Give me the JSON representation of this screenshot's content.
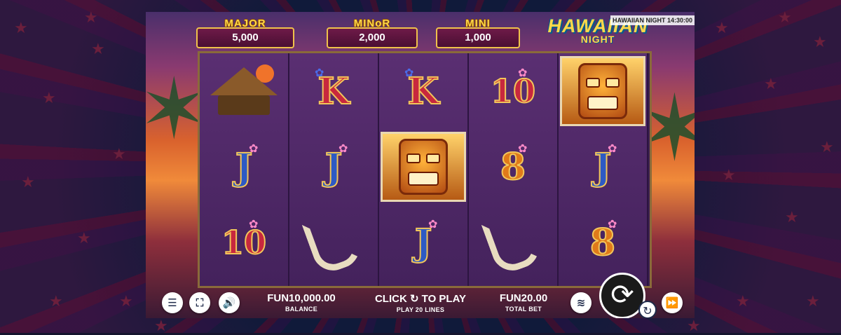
{
  "jackpots": [
    {
      "label": "MAJOR",
      "value": "5,000"
    },
    {
      "label": "MINoR",
      "value": "2,000"
    },
    {
      "label": "MINI",
      "value": "1,000"
    }
  ],
  "logo": {
    "line1": "HAWAIIAN",
    "line2": "NIGHT"
  },
  "clock": "HAWAIIAN NIGHT 14:30:00",
  "reels": [
    [
      "hut",
      "J",
      "10"
    ],
    [
      "K",
      "J",
      "hook"
    ],
    [
      "K",
      "tiki",
      "J"
    ],
    [
      "10",
      "8",
      "hook"
    ],
    [
      "tiki",
      "J",
      "8"
    ]
  ],
  "bottom": {
    "menu_icon": "menu-icon",
    "fullscreen_icon": "fullscreen-icon",
    "sound_icon": "sound-icon",
    "balance_value": "FUN10,000.00",
    "balance_label": "BALANCE",
    "play_prompt": "CLICK ↻ TO PLAY",
    "lines_label": "PLAY 20 LINES",
    "bet_value": "FUN20.00",
    "bet_label": "TOTAL BET",
    "coins_icon": "coins-icon",
    "spin_icon": "spin-icon",
    "autospin_icon": "autospin-icon",
    "turbo_icon": "fast-forward-icon"
  }
}
